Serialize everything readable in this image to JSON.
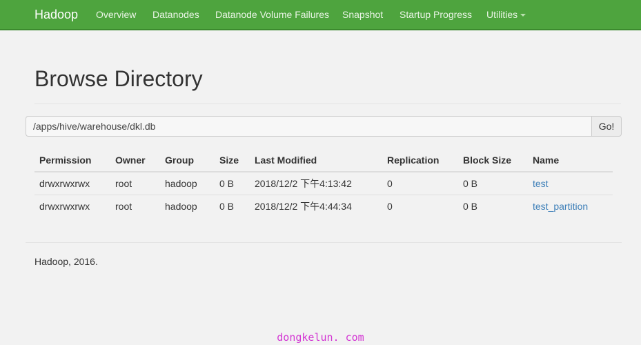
{
  "navbar": {
    "brand": "Hadoop",
    "items": [
      {
        "label": "Overview"
      },
      {
        "label": "Datanodes"
      },
      {
        "label": "Datanode Volume Failures"
      },
      {
        "label": "Snapshot"
      },
      {
        "label": "Startup Progress"
      },
      {
        "label": "Utilities"
      }
    ],
    "accent_color": "#4ea43e"
  },
  "page": {
    "title": "Browse Directory"
  },
  "path_bar": {
    "value": "/apps/hive/warehouse/dkl.db",
    "go_label": "Go!"
  },
  "table": {
    "headers": [
      "Permission",
      "Owner",
      "Group",
      "Size",
      "Last Modified",
      "Replication",
      "Block Size",
      "Name"
    ],
    "rows": [
      {
        "permission": "drwxrwxrwx",
        "owner": "root",
        "group": "hadoop",
        "size": "0 B",
        "last_modified": "2018/12/2 下午4:13:42",
        "replication": "0",
        "block_size": "0 B",
        "name": "test"
      },
      {
        "permission": "drwxrwxrwx",
        "owner": "root",
        "group": "hadoop",
        "size": "0 B",
        "last_modified": "2018/12/2 下午4:44:34",
        "replication": "0",
        "block_size": "0 B",
        "name": "test_partition"
      }
    ]
  },
  "footer": {
    "text": "Hadoop, 2016."
  },
  "watermark": {
    "text": "dongkelun. com"
  }
}
